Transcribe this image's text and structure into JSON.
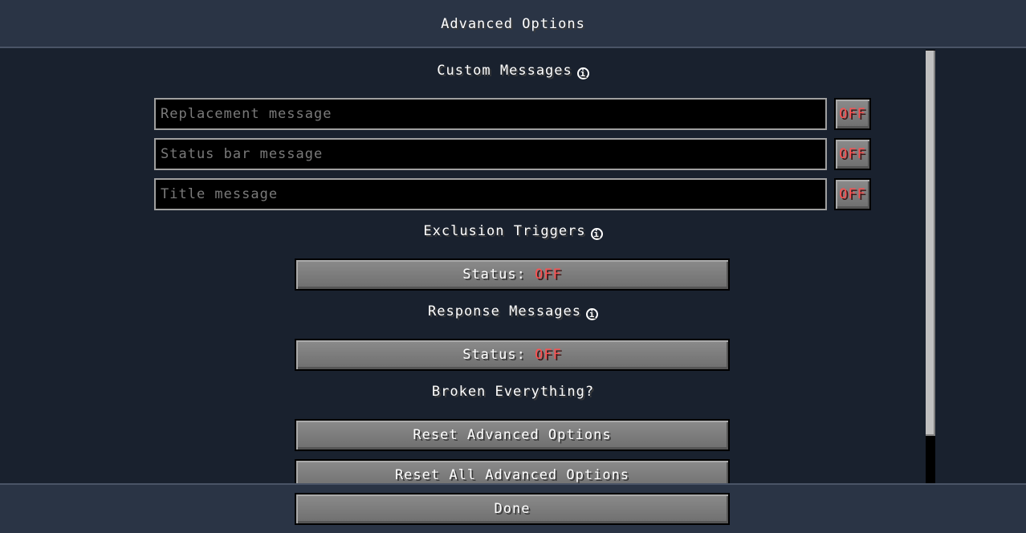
{
  "header": {
    "title": "Advanced Options"
  },
  "custom_messages": {
    "heading": "Custom Messages",
    "info_icon": "info-icon",
    "fields": [
      {
        "placeholder": "Replacement message",
        "value": "",
        "toggle": "OFF"
      },
      {
        "placeholder": "Status bar message",
        "value": "",
        "toggle": "OFF"
      },
      {
        "placeholder": "Title message",
        "value": "",
        "toggle": "OFF"
      }
    ]
  },
  "exclusion_triggers": {
    "heading": "Exclusion Triggers",
    "status_label": "Status:",
    "status_value": "OFF"
  },
  "response_messages": {
    "heading": "Response Messages",
    "status_label": "Status:",
    "status_value": "OFF"
  },
  "broken": {
    "heading": "Broken Everything?",
    "reset_advanced": "Reset Advanced Options",
    "reset_all": "Reset All Advanced Options"
  },
  "footer": {
    "done_label": "Done"
  },
  "colors": {
    "background": "#19212e",
    "panel": "#2a3445",
    "off_red": "#ff4f4f",
    "button_gray": "#7f7f7f"
  }
}
